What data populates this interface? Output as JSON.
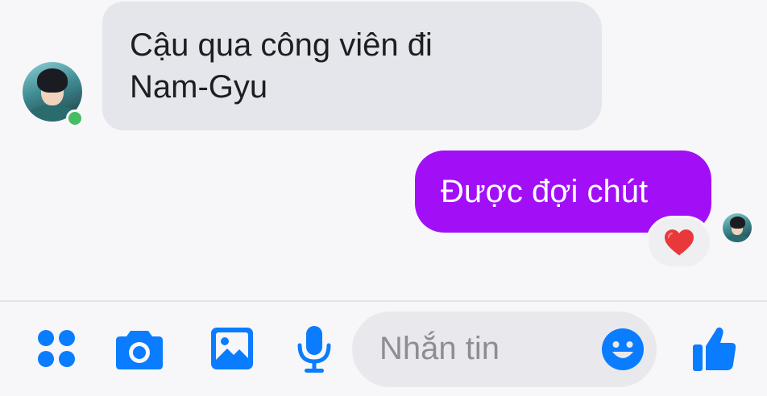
{
  "conversation": {
    "messages": [
      {
        "direction": "incoming",
        "text": "Cậu qua công viên đi\nNam-Gyu",
        "sender_online": true
      },
      {
        "direction": "outgoing",
        "text": "Được đợi chút",
        "reaction": "heart",
        "seen": true
      }
    ]
  },
  "composer": {
    "placeholder": "Nhắn tin"
  },
  "toolbar": {
    "icons": [
      "apps-icon",
      "camera-icon",
      "gallery-icon",
      "microphone-icon",
      "emoji-icon",
      "like-icon"
    ]
  },
  "colors": {
    "accent": "#0a7cff",
    "outgoing_bubble": "#a20ff7",
    "incoming_bubble": "#e5e6eb",
    "online": "#45bd62",
    "heart": "#e8383b"
  }
}
